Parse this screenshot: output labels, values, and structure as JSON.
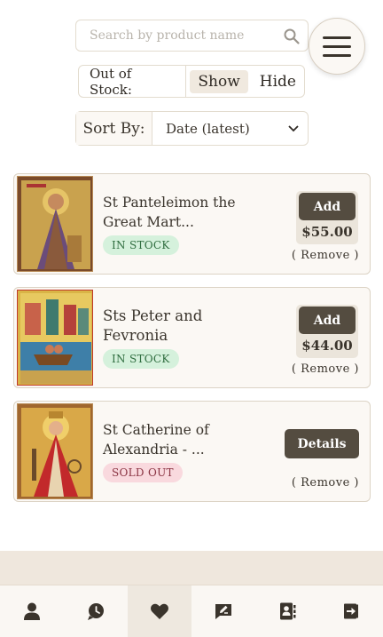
{
  "search": {
    "placeholder": "Search by product name"
  },
  "filters": {
    "out_of_stock_label": "Out of Stock:",
    "show_label": "Show",
    "hide_label": "Hide",
    "selected": "Show",
    "sort_label": "Sort By:",
    "sort_value": "Date (latest)"
  },
  "products": [
    {
      "title_line1": "St Panteleimon the",
      "title_line2": "Great Mart...",
      "status": "IN STOCK",
      "button": "Add",
      "price": "$55.00",
      "remove": "( Remove )"
    },
    {
      "title_line1": "Sts Peter and",
      "title_line2": "Fevronia",
      "status": "IN STOCK",
      "button": "Add",
      "price": "$44.00",
      "remove": "( Remove )"
    },
    {
      "title_line1": "St Catherine of",
      "title_line2": "Alexandria - ...",
      "status": "SOLD OUT",
      "button": "Details",
      "remove": "( Remove )"
    }
  ],
  "nav": {
    "items": [
      "user-icon",
      "chat-icon",
      "heart-icon",
      "message-edit-icon",
      "contacts-icon",
      "logout-icon"
    ],
    "active": "heart-icon"
  },
  "colors": {
    "accent_dark": "#544c40",
    "in_stock_bg": "#d5f1dc",
    "sold_out_bg": "#f9d9de"
  }
}
